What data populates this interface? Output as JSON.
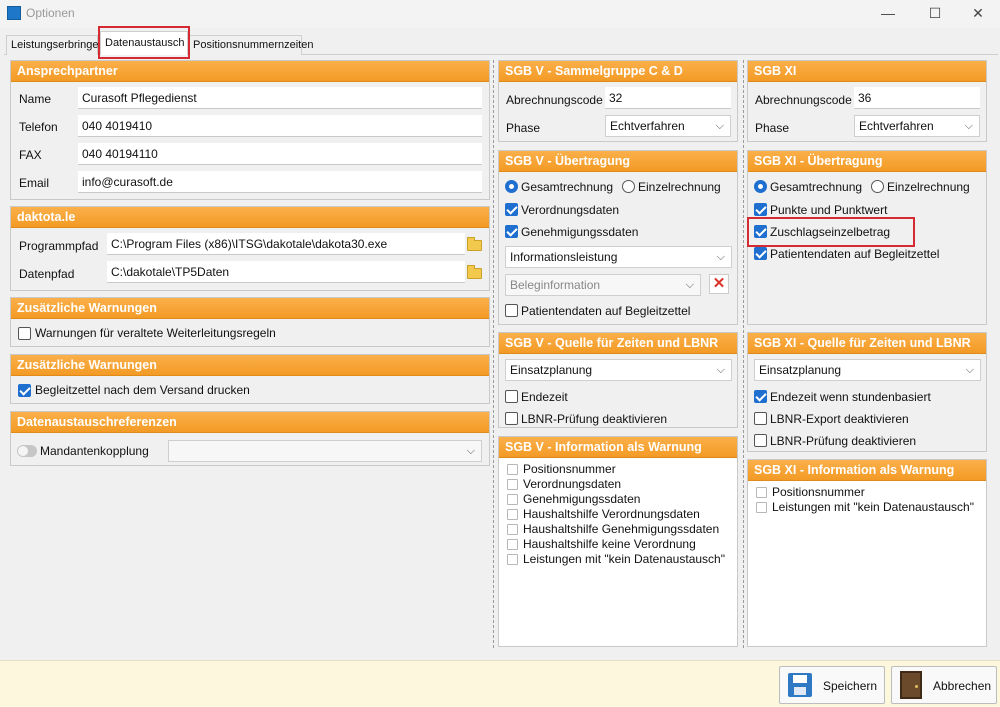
{
  "window": {
    "title": "Optionen",
    "min": "—",
    "max": "☐",
    "close": "✕"
  },
  "tabs": [
    "Leistungserbringer",
    "Datenaustausch",
    "Positionsnummernzeiten"
  ],
  "ansprechpartner": {
    "header": "Ansprechpartner",
    "name_label": "Name",
    "name_value": "Curasoft Pflegedienst",
    "telefon_label": "Telefon",
    "telefon_value": "040 4019410",
    "fax_label": "FAX",
    "fax_value": "040 40194110",
    "email_label": "Email",
    "email_value": "info@curasoft.de"
  },
  "dakota": {
    "header": "daktota.le",
    "programmpfad_label": "Programmpfad",
    "programmpfad_value": "C:\\Program Files (x86)\\ITSG\\dakotale\\dakota30.exe",
    "datenpfad_label": "Datenpfad",
    "datenpfad_value": "C:\\dakotale\\TP5Daten"
  },
  "warnungen1": {
    "header": "Zusätzliche Warnungen",
    "checkbox": "Warnungen für veraltete Weiterleitungsregeln",
    "checked": false
  },
  "warnungen2": {
    "header": "Zusätzliche Warnungen",
    "checkbox": "Begleitzettel nach dem Versand drucken",
    "checked": true
  },
  "referenzen": {
    "header": "Datenaustauschreferenzen",
    "toggle_label": "Mandantenkopplung"
  },
  "sgbv_sammel": {
    "header": "SGB V - Sammelgruppe C & D",
    "code_label": "Abrechnungscode",
    "code_value": "32",
    "phase_label": "Phase",
    "phase_value": "Echtverfahren"
  },
  "sgbv_uebertragung": {
    "header": "SGB V - Übertragung",
    "radio1": "Gesamtrechnung",
    "radio2": "Einzelrechnung",
    "cb1": "Verordnungsdaten",
    "cb2": "Genehmigungssdaten",
    "select1": "Informationsleistung",
    "select2": "Beleginformation",
    "cb3": "Patientendaten auf Begleitzettel"
  },
  "sgbv_quelle": {
    "header": "SGB V - Quelle für Zeiten und LBNR",
    "select": "Einsatzplanung",
    "cb1": "Endezeit",
    "cb2": "LBNR-Prüfung deaktivieren"
  },
  "sgbv_info": {
    "header": "SGB V - Information als Warnung",
    "items": [
      "Positionsnummer",
      "Verordnungsdaten",
      "Genehmigungssdaten",
      "Haushaltshilfe Verordnungsdaten",
      "Haushaltshilfe Genehmigungssdaten",
      "Haushaltshilfe keine Verordnung",
      "Leistungen mit \"kein Datenaustausch\""
    ]
  },
  "sgbxi": {
    "header": "SGB XI",
    "code_label": "Abrechnungscode",
    "code_value": "36",
    "phase_label": "Phase",
    "phase_value": "Echtverfahren"
  },
  "sgbxi_uebertragung": {
    "header": "SGB XI - Übertragung",
    "radio1": "Gesamtrechnung",
    "radio2": "Einzelrechnung",
    "cb1": "Punkte und Punktwert",
    "cb2": "Zuschlagseinzelbetrag",
    "cb3": "Patientendaten auf Begleitzettel"
  },
  "sgbxi_quelle": {
    "header": "SGB XI - Quelle für Zeiten und LBNR",
    "select": "Einsatzplanung",
    "cb1": "Endezeit wenn stundenbasiert",
    "cb2": "LBNR-Export deaktivieren",
    "cb3": "LBNR-Prüfung deaktivieren"
  },
  "sgbxi_info": {
    "header": "SGB XI - Information als Warnung",
    "items": [
      "Positionsnummer",
      "Leistungen mit \"kein Datenaustausch\""
    ]
  },
  "footer": {
    "save": "Speichern",
    "cancel": "Abbrechen"
  }
}
